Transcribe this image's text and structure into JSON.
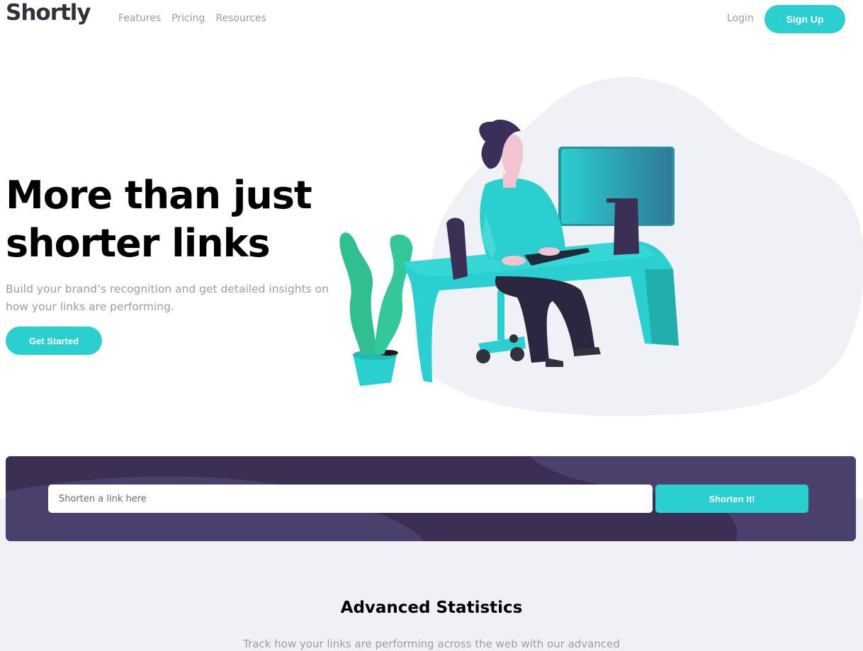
{
  "nav": {
    "logo": "Shortly",
    "links": [
      "Features",
      "Pricing",
      "Resources"
    ],
    "login": "Login",
    "signup": "Sign Up"
  },
  "hero": {
    "title": "More than just shorter links",
    "subtitle": "Build your brand’s recognition and get detailed insights on how your links are performing.",
    "cta": "Get Started"
  },
  "shorten": {
    "placeholder": "Shorten a link here",
    "button": "Shorten It!"
  },
  "stats": {
    "title": "Advanced Statistics",
    "subtitle": "Track how your links are performing across the web with our advanced"
  },
  "colors": {
    "cyan": "#2acfcf",
    "dark_violet": "#3b3054",
    "grayish_violet": "#9e9aa7",
    "very_dark_blue": "#34313d",
    "light_gray_band": "#f0f1f6"
  }
}
